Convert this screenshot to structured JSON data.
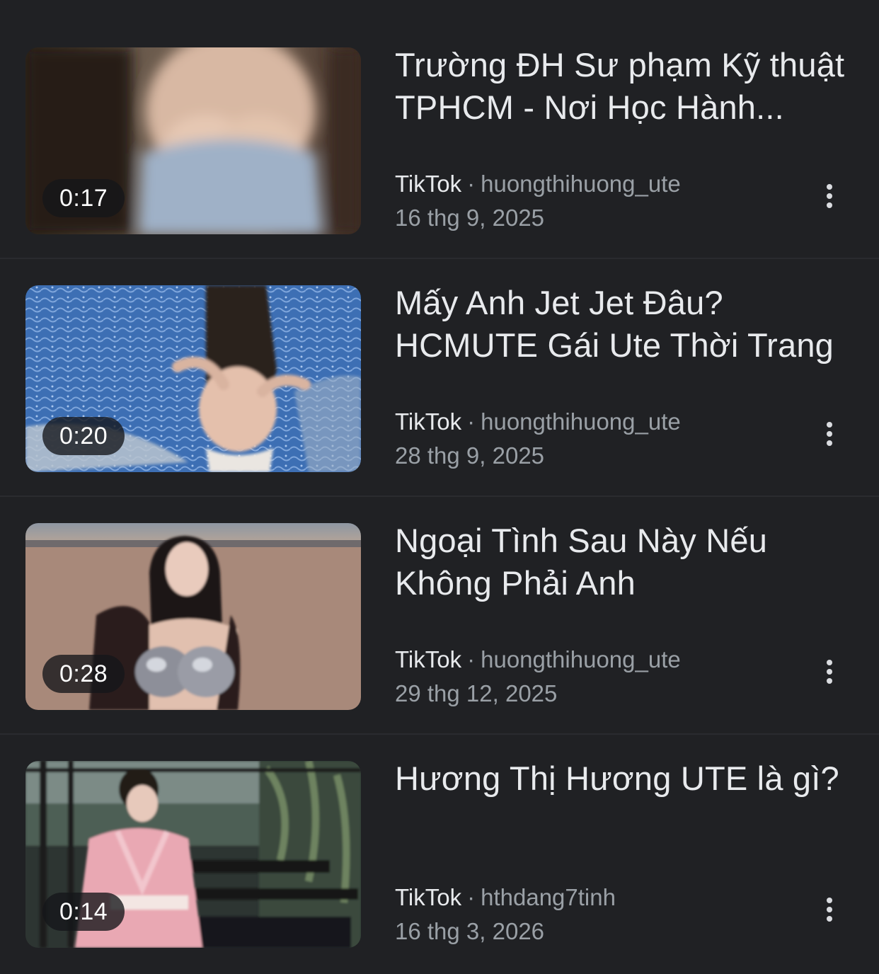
{
  "results": [
    {
      "title": "Trường ĐH Sư phạm Kỹ thuật TPHCM - Nơi Học Hành...",
      "duration": "0:17",
      "source": "TikTok",
      "separator": "·",
      "channel": "huongthihuong_ute",
      "date": "16 thg 9, 2025"
    },
    {
      "title": "Mấy Anh Jet Jet Đâu? HCMUTE Gái Ute Thời Trang",
      "duration": "0:20",
      "source": "TikTok",
      "separator": "·",
      "channel": "huongthihuong_ute",
      "date": "28 thg 9, 2025"
    },
    {
      "title": "Ngoại Tình Sau Này Nếu Không Phải Anh",
      "duration": "0:28",
      "source": "TikTok",
      "separator": "·",
      "channel": "huongthihuong_ute",
      "date": "29 thg 12, 2025"
    },
    {
      "title": "Hương Thị Hương UTE là gì?",
      "duration": "0:14",
      "source": "TikTok",
      "separator": "·",
      "channel": "hthdang7tinh",
      "date": "16 thg 3, 2026"
    }
  ],
  "icons": {
    "more_options": "more-vert-icon"
  },
  "colors": {
    "background": "#202124",
    "title_text": "#e8eaed",
    "secondary_text": "#9aa0a6",
    "duration_badge": "#14161a"
  }
}
